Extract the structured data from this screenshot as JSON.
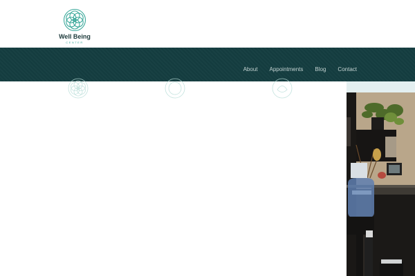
{
  "brand": {
    "name": "Well Being",
    "subtitle": "CENTER",
    "logo_icon": "flower-of-life-icon",
    "colors": {
      "accent": "#3aa89a",
      "text": "#1d3a3b",
      "navbar": "#143d40",
      "nav_text": "#c4d3d2"
    }
  },
  "nav": {
    "items": [
      {
        "label": "About"
      },
      {
        "label": "Appointments"
      },
      {
        "label": "Blog"
      },
      {
        "label": "Contact"
      }
    ]
  },
  "emblems": [
    {
      "icon": "flower-of-life-icon"
    },
    {
      "icon": "circle-ornament-icon"
    },
    {
      "icon": "circle-ornament-icon"
    }
  ],
  "photo": {
    "description_icon": "office-photo-icon"
  }
}
